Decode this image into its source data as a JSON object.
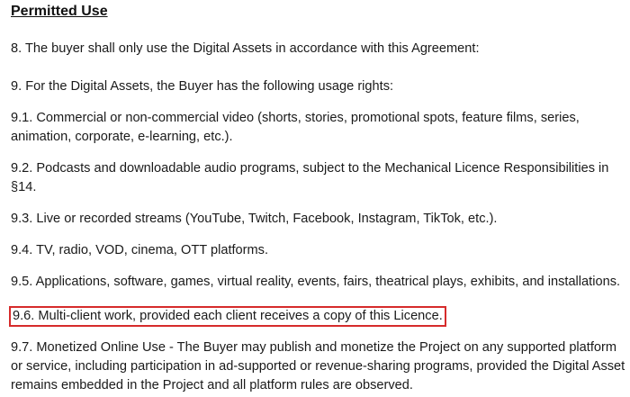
{
  "document": {
    "heading": "Permitted Use",
    "paragraphs": [
      "8. The buyer shall only use the Digital Assets in accordance with this Agreement:",
      "9. For the Digital Assets, the Buyer has the following usage rights:",
      "9.1. Commercial or non-commercial video (shorts, stories, promotional spots, feature films, series, animation, corporate, e-learning, etc.).",
      "9.2. Podcasts and downloadable audio programs, subject to the Mechanical Licence Responsibilities in §14.",
      "9.3. Live or recorded streams (YouTube, Twitch, Facebook, Instagram, TikTok, etc.).",
      "9.4. TV, radio, VOD, cinema, OTT platforms.",
      "9.5. Applications, software, games, virtual reality, events, fairs, theatrical plays, exhibits, and installations.",
      "9.6. Multi-client work, provided each client receives a copy of this Licence.",
      "9.7. Monetized Online Use - The Buyer may publish and monetize the Project on any supported platform or service, including participation in ad-supported or revenue-sharing programs, provided the Digital Asset remains embedded in the Project and all platform rules are observed."
    ]
  },
  "colors": {
    "highlight_border": "#d62b2b",
    "text": "#1a1a1a",
    "background": "#ffffff"
  }
}
